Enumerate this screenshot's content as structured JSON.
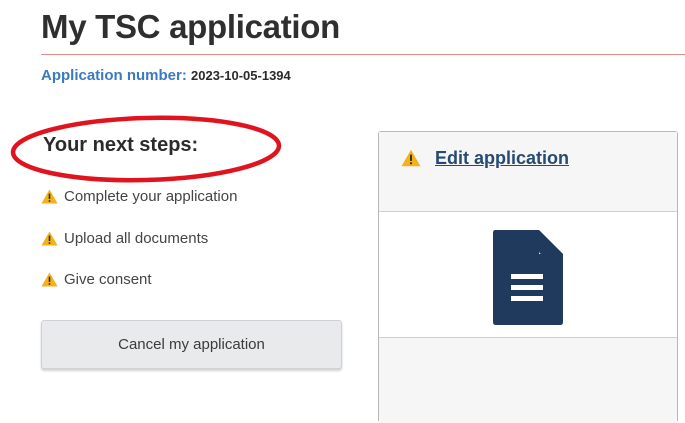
{
  "header": {
    "title": "My TSC application",
    "application_number_label": "Application number:",
    "application_number_value": "2023-10-05-1394"
  },
  "next_steps": {
    "title": "Your next steps:",
    "items": [
      {
        "label": "Complete your application",
        "icon": "warning-icon"
      },
      {
        "label": "Upload all documents",
        "icon": "warning-icon"
      },
      {
        "label": "Give consent",
        "icon": "warning-icon"
      }
    ]
  },
  "actions": {
    "cancel_label": "Cancel my application"
  },
  "panel": {
    "edit_label": "Edit application",
    "header_icon": "warning-icon",
    "body_icon": "document-icon"
  },
  "colors": {
    "accent_blue": "#3a7bc0",
    "link_navy": "#264a73",
    "warning_yellow": "#f3b21b",
    "annotation_red": "#e0141e",
    "title_rule": "#e58a8a"
  }
}
